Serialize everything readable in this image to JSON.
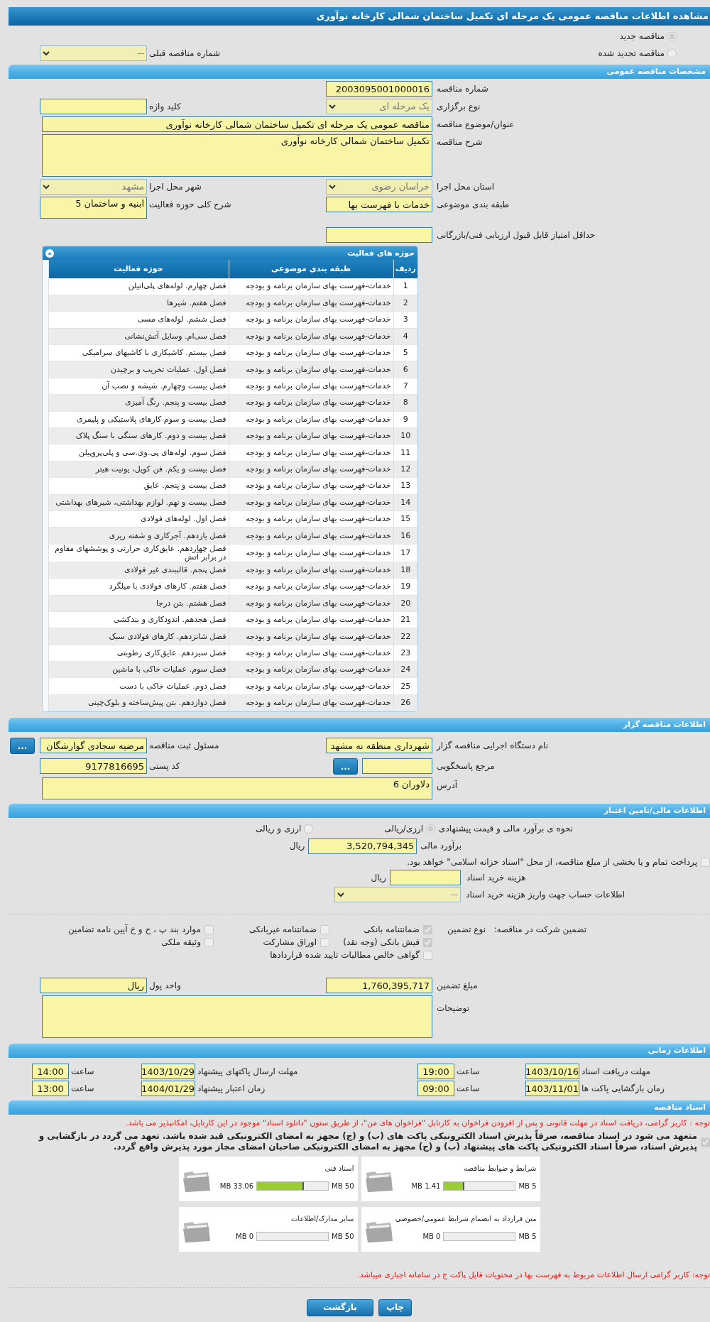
{
  "page_title": "مشاهده اطلاعات مناقصه عمومی یک مرحله ای تکمیل ساختمان شمالی کارخانه نوآوری",
  "tender_type": [
    {
      "label": "مناقصه جدید",
      "selected": true
    },
    {
      "label": "مناقصه تجدید شده",
      "selected": false
    }
  ],
  "previous_tender": {
    "label": "شماره مناقصه قبلی",
    "value": "--"
  },
  "general": {
    "title": "مشخصات مناقصه عمومی",
    "rows": [
      {
        "cells": [
          {
            "label": "شماره مناقصه",
            "kind": "input",
            "value": "2003095001000016"
          }
        ]
      },
      {
        "cells": [
          {
            "label": "نوع برگزاری",
            "kind": "select",
            "value": "یک مرحله ای"
          },
          {
            "label": "کلید واژه",
            "kind": "input"
          }
        ]
      },
      {
        "cells": [
          {
            "label": "عنوان/موضوع مناقصه",
            "kind": "long_input",
            "value": "مناقصه عمومی یک مرحله ای تکمیل ساختمان شمالی کارخانه نوآوری"
          }
        ]
      },
      {
        "cells": [
          {
            "label": "شرح مناقصه",
            "kind": "long_textarea",
            "value": "تکمیل ساختمان شمالی کارخانه نوآوری"
          }
        ]
      },
      {
        "cells": [
          {
            "label": "استان محل اجرا",
            "kind": "select",
            "value": "خراسان رضوی"
          },
          {
            "label": "شهر محل اجرا",
            "kind": "select",
            "value": "مشهد"
          }
        ]
      },
      {
        "cells": [
          {
            "label": "طبقه بندی موضوعی",
            "kind": "input",
            "value": "خدمات با فهرست بها"
          },
          {
            "label": "شرح کلی حوزه فعالیت",
            "kind": "textarea",
            "value": "ابنیه و ساختمان 5"
          }
        ]
      },
      {
        "cells": [
          {
            "label": "حداقل امتیاز قابل قبول ارزیابی فنی/بازرگانی",
            "kind": "input"
          }
        ]
      }
    ]
  },
  "activities": {
    "title": "حوزه های فعالیت",
    "columns": [
      "ردیف",
      "طبقه بندی موضوعی",
      "حوزه فعالیت"
    ],
    "rows": [
      [
        "1",
        "خدمات-فهرست بهای سازمان برنامه و بودجه",
        "فصل چهارم. لوله‌های پلی‌اتیلن"
      ],
      [
        "2",
        "خدمات-فهرست بهای سازمان برنامه و بودجه",
        "فصل هفتم. شیرها"
      ],
      [
        "3",
        "خدمات-فهرست بهای سازمان برنامه و بودجه",
        "فصل ششم. لوله‌های مسی"
      ],
      [
        "4",
        "خدمات-فهرست بهای سازمان برنامه و بودجه",
        "فصل سی‌ام. وسایل آتش‌نشانی"
      ],
      [
        "5",
        "خدمات-فهرست بهای سازمان برنامه و بودجه",
        "فصل بیستم. کاشیکاری با کاشیهای سرامیکی"
      ],
      [
        "6",
        "خدمات-فهرست بهای سازمان برنامه و بودجه",
        "فصل اول. عملیات تخریب و برچیدن"
      ],
      [
        "7",
        "خدمات-فهرست بهای سازمان برنامه و بودجه",
        "فصل بیست وچهارم. شیشه و نصب آن"
      ],
      [
        "8",
        "خدمات-فهرست بهای سازمان برنامه و بودجه",
        "فصل بیست و پنجم. رنگ آمیزی"
      ],
      [
        "9",
        "خدمات-فهرست بهای سازمان برنامه و بودجه",
        "فصل بیست و سوم کارهای پلاستیکی و پلیمری"
      ],
      [
        "10",
        "خدمات-فهرست بهای سازمان برنامه و بودجه",
        "فصل بیست و دوم. کارهای سنگی با سنگ پلاک"
      ],
      [
        "11",
        "خدمات-فهرست بهای سازمان برنامه و بودجه",
        "فصل سوم. لوله‌های پی.وی.سی و پلی‌پروپیلن"
      ],
      [
        "12",
        "خدمات-فهرست بهای سازمان برنامه و بودجه",
        "فصل بیست و یکم. فن کویل، یونیت هیتر"
      ],
      [
        "13",
        "خدمات-فهرست بهای سازمان برنامه و بودجه",
        "فصل بیست و پنجم. عایق"
      ],
      [
        "14",
        "خدمات-فهرست بهای سازمان برنامه و بودجه",
        "فصل بیست و نهم. لوازم بهداشتی، شیرهای بهداشتی"
      ],
      [
        "15",
        "خدمات-فهرست بهای سازمان برنامه و بودجه",
        "فصل اول. لوله‌های فولادی"
      ],
      [
        "16",
        "خدمات-فهرست بهای سازمان برنامه و بودجه",
        "فصل یازدهم. آجرکاری و شفته ریزی"
      ],
      [
        "17",
        "خدمات-فهرست بهای سازمان برنامه و بودجه",
        "فصل چهاردهم. عایق‌کاری حرارتی و پوششهای مقاوم در برابر آتش"
      ],
      [
        "18",
        "خدمات-فهرست بهای سازمان برنامه و بودجه",
        "فصل پنجم. قالببندی غیر فولادی"
      ],
      [
        "19",
        "خدمات-فهرست بهای سازمان برنامه و بودجه",
        "فصل هفتم. کارهای فولادی با میلگرد"
      ],
      [
        "20",
        "خدمات-فهرست بهای سازمان برنامه و بودجه",
        "فصل هشتم. بتن درجا"
      ],
      [
        "21",
        "خدمات-فهرست بهای سازمان برنامه و بودجه",
        "فصل هجدهم. اندودکاری و بندکشی"
      ],
      [
        "22",
        "خدمات-فهرست بهای سازمان برنامه و بودجه",
        "فصل شانزدهم. کارهای فولادی سبک"
      ],
      [
        "23",
        "خدمات-فهرست بهای سازمان برنامه و بودجه",
        "فصل سیزدهم. عایق‌کاری رطوبتی"
      ],
      [
        "24",
        "خدمات-فهرست بهای سازمان برنامه و بودجه",
        "فصل سوم. عملیات خاکی با ماشین"
      ],
      [
        "25",
        "خدمات-فهرست بهای سازمان برنامه و بودجه",
        "فصل دوم. عملیات خاکی با دست"
      ],
      [
        "26",
        "خدمات-فهرست بهای سازمان برنامه و بودجه",
        "فصل دوازدهم. بتن پیش‌ساخته و بلوک‌چینی"
      ]
    ]
  },
  "tenderer": {
    "title": "اطلاعات مناقصه گزار",
    "rows": [
      {
        "cells": [
          {
            "label": "نام دستگاه اجرایی مناقصه گزار",
            "kind": "input",
            "value": "شهرداری منطقه نه مشهد"
          },
          {
            "label": "مسئول ثبت مناقصه",
            "kind": "input",
            "value": "مرضیه سجادی گوارشگان",
            "button": "..."
          }
        ]
      },
      {
        "cells": [
          {
            "label": "مرجع پاسخگویی",
            "kind": "short_input",
            "button": "..."
          },
          {
            "label": "کد پستی",
            "kind": "input",
            "value": "9177816695"
          }
        ]
      },
      {
        "cells": [
          {
            "label": "آدرس",
            "kind": "long_textarea",
            "value": "دلاوران 6"
          }
        ]
      }
    ]
  },
  "financial": {
    "title": "اطلاعات مالی/تامین اعتبار",
    "estimate_method": {
      "label": "نحوه ی برآورد مالی و قیمت پیشنهادی",
      "options": [
        {
          "label": "ارزی/ریالی",
          "selected": true
        },
        {
          "label": "ارزی و ریالی",
          "selected": false
        }
      ]
    },
    "estimate": {
      "label": "برآورد مالی",
      "value": "3,520,794,345",
      "unit": "ریال"
    },
    "treasury": {
      "label": "پرداخت تمام و یا بخشی از مبلغ مناقصه، از محل \"اسناد خزانه اسلامی\" خواهد بود.",
      "checked": false
    },
    "doc_fee": {
      "label": "هزینه خرید اسناد",
      "unit": "ریال"
    },
    "account": {
      "label": "اطلاعات حساب جهت واریز هزینه خرید اسناد",
      "value": "--"
    }
  },
  "guarantee": {
    "label": "تضمین شرکت در مناقصه:",
    "type_label": "نوع تضمین",
    "options": [
      {
        "label": "ضمانتنامه بانکی",
        "checked": true
      },
      {
        "label": "ضمانتنامه غیربانکی",
        "checked": false
      },
      {
        "label": "موارد بند پ ، ح و خ آیین نامه تضامین",
        "checked": false
      },
      {
        "label": "فیش بانکی (وجه نقد)",
        "checked": true
      },
      {
        "label": "اوراق مشارکت",
        "checked": false
      },
      {
        "label": "وثیقه ملکی",
        "checked": false
      },
      {
        "label": "گواهی خالص مطالبات تایید شده قراردادها",
        "checked": false
      }
    ],
    "amount": {
      "label": "مبلغ تضمین",
      "value": "1,760,395,717"
    },
    "currency": {
      "label": "واحد پول",
      "value": "ریال"
    },
    "notes": {
      "label": "توضیحات"
    }
  },
  "timing": {
    "title": "اطلاعات زمانی",
    "rows": [
      [
        {
          "label": "مهلت دریافت اسناد",
          "date": "1403/10/16",
          "time_label": "ساعت",
          "time": "19:00"
        },
        {
          "label": "مهلت ارسال پاکتهای پیشنهاد",
          "date": "1403/10/29",
          "time_label": "ساعت",
          "time": "14:00"
        }
      ],
      [
        {
          "label": "زمان بازگشایی پاکت ها",
          "date": "1403/11/01",
          "time_label": "ساعت",
          "time": "09:00"
        },
        {
          "label": "زمان اعتبار پیشنهاد",
          "date": "1404/01/29",
          "time_label": "ساعت",
          "time": "13:00"
        }
      ]
    ]
  },
  "documents": {
    "title": "اسناد مناقصه",
    "notice": "توجه : کاربر گرامی، دریافت اسناد در مهلت قانونی و پس از افزودن فراخوان به کارتابل \"فراخوان های من\"، از طریق ستون \"دانلود اسناد\" موجود در این کارتابل، امکانپذیر می باشد.",
    "commitment": {
      "text": "متعهد می شود در اسناد مناقصه، صرفاً پذیرش اسناد الکترونیکی پاکت های (ب) و (ج) مجهز به امضای الکترونیکی قید شده باشد. تعهد می گردد در بازگشایی و پذیرش اسناد، صرفاً اسناد الکترونیکی پاکت های پیشنهاد (ب) و (ج) مجهز به امضای الکترونیکی صاحبان امضای مجاز مورد پذیرش واقع گردد.",
      "checked": true
    },
    "files": [
      {
        "name": "شرایط و ضوابط مناقصه",
        "size": "1.41 MB",
        "limit": "5 MB",
        "level": 0.282
      },
      {
        "name": "اسناد فنی",
        "size": "33.06 MB",
        "limit": "50 MB",
        "level": 0.661
      },
      {
        "name": "متن قرارداد به انضمام شرایط عمومی/خصوصی",
        "size": "0 MB",
        "limit": "5 MB",
        "level": 0
      },
      {
        "name": "سایر مدارک/اطلاعات",
        "size": "0 MB",
        "limit": "50 MB",
        "level": 0
      }
    ],
    "footer_notice": "توجه: کاربر گرامی ارسال اطلاعات مربوط به فهرست بها در محتویات فایل پاکت ج در سامانه اجباری میباشد."
  },
  "buttons": [
    "چاپ",
    "بازگشت"
  ]
}
